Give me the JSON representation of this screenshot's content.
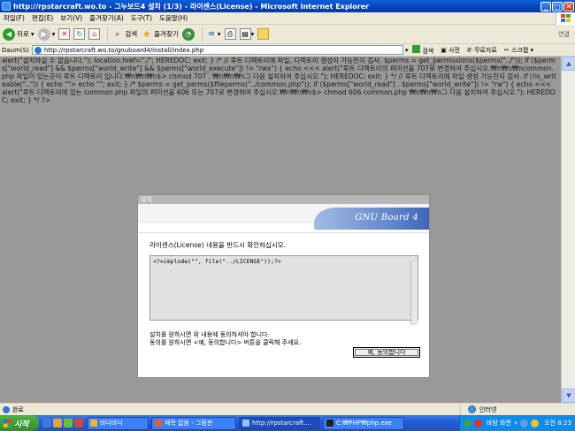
{
  "window": {
    "title": "http://rpstarcraft.wo.to - 그누보드4 설치 (1/3) - 라이센스(License) - Microsoft Internet Explorer",
    "min": "_",
    "max": "□",
    "close": "✕"
  },
  "menu": [
    "파일(F)",
    "편집(E)",
    "보기(V)",
    "즐겨찾기(A)",
    "도구(T)",
    "도움말(H)"
  ],
  "toolbar": {
    "back": "뒤로",
    "search": "검색",
    "favorites": "즐겨찾기",
    "links": "연결"
  },
  "address": {
    "label": "Daum(S)",
    "url": "http://rpstarcraft.wo.to/gnuboard4/install/index.php",
    "go_search": "검색",
    "dictionary": "사전",
    "free_calls": "무료자료",
    "scrap": "스크랩"
  },
  "content": {
    "php_source": "alert(\"설치하실 수 없습니다.\"); location.href=\"./\"; HEREDOC; exit; } /* // 루트 디렉토리에 파일, 디렉토리 생성이 가능한지 검사. $perms = get_permissions($perms(\"../\")); if ($perms[\"world_read\"] && $perms[\"world_write\"] && $perms[\"world_execute\"]) != \"rwx\") { echo <<< alert(\"루트 디렉토리의 퍼미션을 707로 변경하여 주십시오.₩n₩n₩ncommon.php 파일이 있는곳이 루트 디렉토리 입니다.₩n₩n₩n$> chmod 707 . ₩n₩n₩n그 다음 설치하여 주십시오.\"); HEREDOC; exit; } */ // 루트 디렉토리에 파일 생성 가능한지 검사. if (!is_writeable(\"..\")) { echo \"\"> echo \"\"; exit; } /* $perms = get_perms($fileperms(\"../common.php\")); if ($perms[\"world_read\"] . $perms[\"world_write\"]) != \"rw\") { echo <<< alert(\"루트 디렉토리에 있는 common.php 파일의 퍼미션을 606 또는 707로 변경하여 주십시오.₩n₩n₩n$> chmod 606 common.php ₩n₩n₩n그 다음 설치하여 주십시오.\"); HEREDOC; exit; } */ ?>"
  },
  "dialog": {
    "title": "설치",
    "logo_text": "GNU Board 4",
    "notice": "라이센스(License) 내용을 반드시 확인하십시오.",
    "license_text": "<?=implode(\"\", file(\"../LICENSE\"));?>",
    "instruction_line1": "설치를 원하시면 위 내용에 동의하셔야 합니다.",
    "instruction_line2": "동의를 원하시면 <예, 동의합니다> 버튼을 클릭해 주세요.",
    "agree_button": "예, 동의합니다"
  },
  "status": {
    "text": "완료",
    "zone": "인터넷"
  },
  "taskbar": {
    "start": "시작",
    "items": [
      {
        "label": "바디바디"
      },
      {
        "label": "제목 없음 - 그림판"
      },
      {
        "label": "http://rpstarcraft...."
      },
      {
        "label": "C:₩PHP₩php.exe"
      }
    ],
    "tray_text": "바탕 화면",
    "clock": "오전 8:23"
  },
  "colors": {
    "title_blue": "#0a5fd8",
    "content_gray": "#9b9896",
    "logo_blue": "#3e67b9",
    "taskbar_blue": "#245edb",
    "start_green": "#3c9b36"
  }
}
